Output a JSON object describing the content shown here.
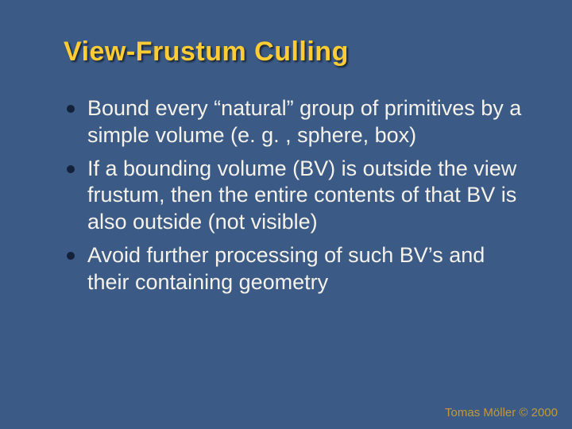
{
  "slide": {
    "title": "View-Frustum Culling",
    "bullets": [
      "Bound every “natural” group of primitives by a simple volume (e. g. , sphere, box)",
      "If a bounding volume (BV) is outside the view frustum, then the entire contents of that BV is also outside (not visible)",
      "Avoid further processing of such BV’s and their containing geometry"
    ],
    "footer": "Tomas Möller © 2000"
  }
}
